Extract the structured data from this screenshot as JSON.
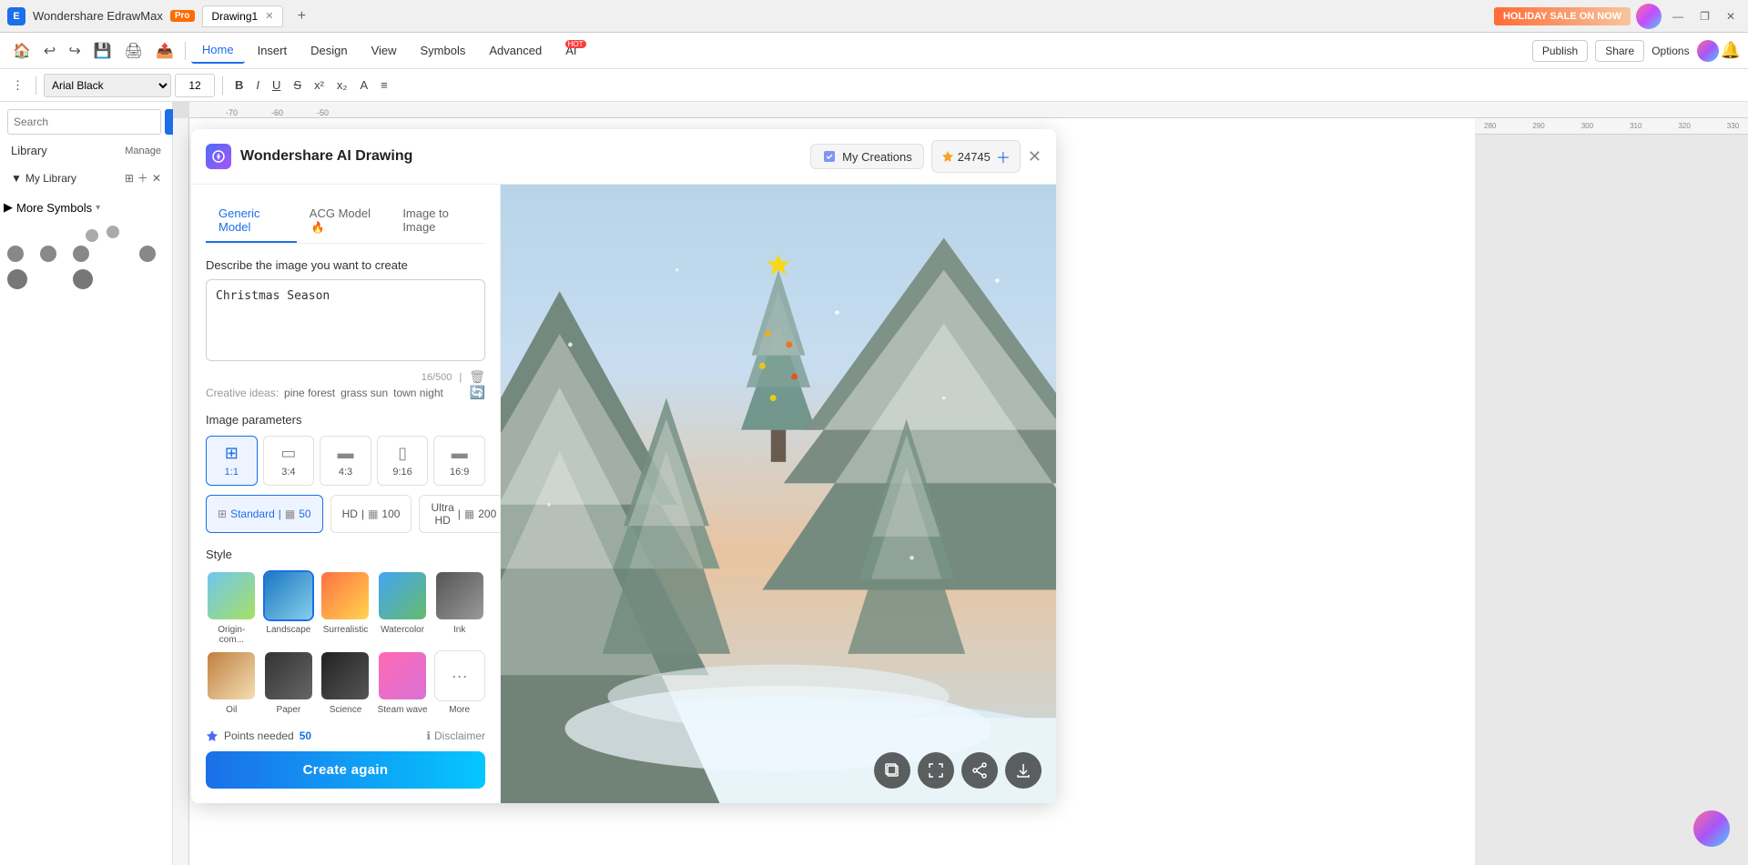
{
  "titlebar": {
    "app_name": "Wondershare EdrawMax",
    "pro_label": "Pro",
    "tab_name": "Drawing1",
    "add_tab_label": "+",
    "holiday_btn": "HOLIDAY SALE ON NOW",
    "win_min": "—",
    "win_restore": "❐",
    "win_close": "✕"
  },
  "menubar": {
    "tabs": [
      {
        "id": "home",
        "label": "Home",
        "active": true
      },
      {
        "id": "insert",
        "label": "Insert",
        "active": false
      },
      {
        "id": "design",
        "label": "Design",
        "active": false
      },
      {
        "id": "view",
        "label": "View",
        "active": false
      },
      {
        "id": "symbols",
        "label": "Symbols",
        "active": false
      },
      {
        "id": "advanced",
        "label": "Advanced",
        "active": false
      },
      {
        "id": "ai",
        "label": "AI",
        "active": false,
        "hot": true
      }
    ],
    "publish_label": "Publish",
    "share_label": "Share",
    "options_label": "Options"
  },
  "toolbar": {
    "font_family": "Arial Black",
    "font_size": "12",
    "bold": "B",
    "italic": "I",
    "underline": "U"
  },
  "sidebar": {
    "search_placeholder": "Search",
    "search_btn": "Search",
    "library_label": "Library",
    "manage_label": "Manage",
    "my_library_label": "My Library",
    "more_symbols_label": "More Symbols"
  },
  "ai_panel": {
    "title": "Wondershare AI Drawing",
    "my_creations_label": "My Creations",
    "credits": "24745",
    "close_label": "✕",
    "tabs": [
      {
        "id": "generic",
        "label": "Generic Model",
        "active": true
      },
      {
        "id": "acg",
        "label": "ACG Model",
        "active": false,
        "fire": true
      },
      {
        "id": "img2img",
        "label": "Image to Image",
        "active": false
      }
    ],
    "describe_label": "Describe the image you want to create",
    "description_text": "Christmas Season",
    "char_count": "16/500",
    "creative_ideas_label": "Creative ideas:",
    "ideas": [
      "pine forest",
      "grass sun",
      "town night"
    ],
    "params_label": "Image parameters",
    "ratios": [
      {
        "id": "1:1",
        "label": "1:1",
        "active": true
      },
      {
        "id": "3:4",
        "label": "3:4",
        "active": false
      },
      {
        "id": "4:3",
        "label": "4:3",
        "active": false
      },
      {
        "id": "9:16",
        "label": "9:16",
        "active": false
      },
      {
        "id": "16:9",
        "label": "16:9",
        "active": false
      }
    ],
    "quality": [
      {
        "id": "standard",
        "label": "Standard",
        "value": "50",
        "active": true
      },
      {
        "id": "hd",
        "label": "HD",
        "value": "100",
        "active": false
      },
      {
        "id": "ultrahd",
        "label": "Ultra HD",
        "value": "200",
        "active": false
      }
    ],
    "style_label": "Style",
    "styles": [
      {
        "id": "origin",
        "label": "Origin-com...",
        "active": false
      },
      {
        "id": "landscape",
        "label": "Landscape",
        "active": true
      },
      {
        "id": "surrealistic",
        "label": "Surrealistic",
        "active": false
      },
      {
        "id": "watercolor",
        "label": "Watercolor",
        "active": false
      },
      {
        "id": "ink",
        "label": "Ink",
        "active": false
      },
      {
        "id": "oil",
        "label": "Oil",
        "active": false
      },
      {
        "id": "paper",
        "label": "Paper",
        "active": false
      },
      {
        "id": "science",
        "label": "Science",
        "active": false
      },
      {
        "id": "steam_wave",
        "label": "Steam wave",
        "active": false
      }
    ],
    "more_label": "More",
    "points_label": "Points needed",
    "points_value": "50",
    "disclaimer_label": "Disclaimer",
    "create_btn": "Create again"
  }
}
